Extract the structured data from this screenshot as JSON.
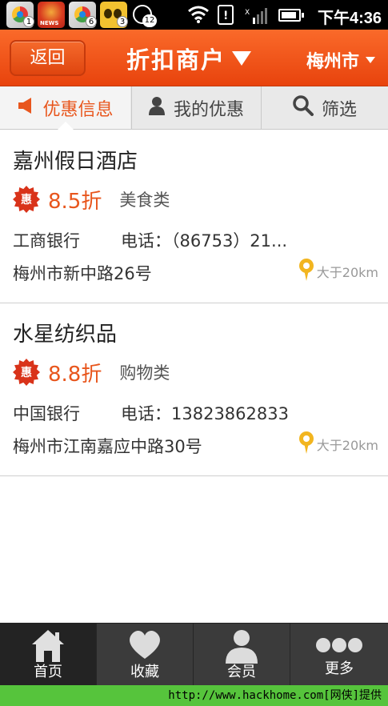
{
  "status_bar": {
    "notification_badges": [
      "1",
      "6",
      "3"
    ],
    "message_badge": "12",
    "time": "下午4:36",
    "news_label": "NEWS"
  },
  "header": {
    "back_label": "返回",
    "title": "折扣商户",
    "city": "梅州市"
  },
  "tabs": [
    {
      "label": "优惠信息",
      "icon": "megaphone-icon",
      "active": true
    },
    {
      "label": "我的优惠",
      "icon": "user-icon",
      "active": false
    },
    {
      "label": "筛选",
      "icon": "search-icon",
      "active": false
    }
  ],
  "merchants": [
    {
      "name": "嘉州假日酒店",
      "badge": "惠",
      "discount": "8.5折",
      "category": "美食类",
      "bank": "工商银行",
      "phone": "电话：（86753）21...",
      "address": "梅州市新中路26号",
      "distance": "大于20km"
    },
    {
      "name": "水星纺织品",
      "badge": "惠",
      "discount": "8.8折",
      "category": "购物类",
      "bank": "中国银行",
      "phone": "电话：13823862833",
      "address": "梅州市江南嘉应中路30号",
      "distance": "大于20km"
    }
  ],
  "bottom_nav": [
    {
      "label": "首页",
      "icon": "home-icon",
      "active": true
    },
    {
      "label": "收藏",
      "icon": "heart-icon",
      "active": false
    },
    {
      "label": "会员",
      "icon": "member-icon",
      "active": false
    },
    {
      "label": "更多",
      "icon": "more-icon",
      "active": false
    }
  ],
  "watermark": "http://www.hackhome.com[网侠]提供",
  "colors": {
    "accent": "#e8561d",
    "header_top": "#fa6a2a",
    "header_bottom": "#e8430d",
    "badge_red": "#d9331a",
    "pin_yellow": "#f2b51f",
    "nav_bg": "#3b3b3b"
  }
}
